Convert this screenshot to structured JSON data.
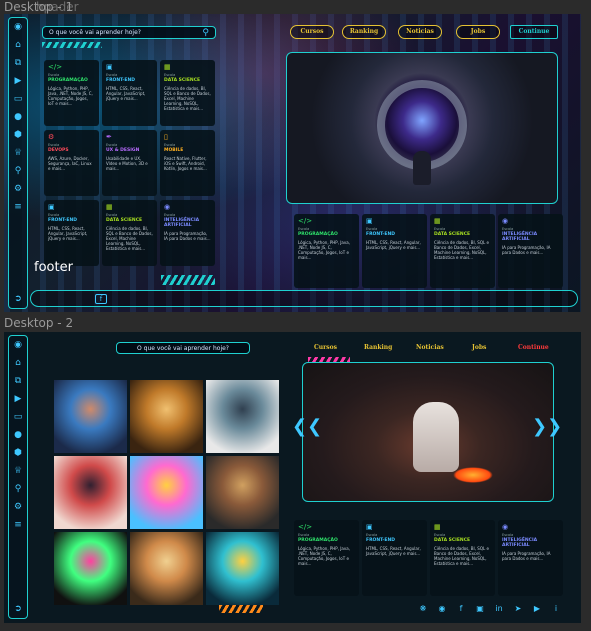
{
  "frames": {
    "desktop1_label": "Desktop - 1",
    "desktop2_label": "Desktop - 2",
    "overlap_label": "hpader"
  },
  "desktop1": {
    "search": {
      "placeholder": "O que você vai aprender hoje?"
    },
    "nav": [
      "Cursos",
      "Ranking",
      "Noticias",
      "Jobs"
    ],
    "continue_label": "Continue",
    "footer_label": "footer",
    "cards": [
      {
        "label": "Escola",
        "title": "PROGRAMAÇÃO",
        "desc": "Lógica, Python, PHP, Java, .NET, Node JS, C, Computação, Jogos, IoT e mais...",
        "color": "#2ee06a",
        "icon": "code-icon"
      },
      {
        "label": "Escola",
        "title": "FRONT-END",
        "desc": "HTML, CSS, React, Angular, JavaScript, jQuery e mais...",
        "color": "#3ec8ff",
        "icon": "window-icon"
      },
      {
        "label": "Escola",
        "title": "DATA SCIENCE",
        "desc": "Ciência de dados, BI, SQL e Banco de Dados, Excel, Machine Learning, NoSQL, Estatística e mais...",
        "color": "#a8e020",
        "icon": "grid-icon"
      },
      {
        "label": "Escola",
        "title": "DEVOPS",
        "desc": "AWS, Azure, Docker, Segurança, IaC, Linux e mais...",
        "color": "#ff4a5a",
        "icon": "gear-icon"
      },
      {
        "label": "Escola",
        "title": "UX & DESIGN",
        "desc": "Usabilidade e UX, Vídeo e Motion, 3D e mais...",
        "color": "#b86aff",
        "icon": "pen-icon"
      },
      {
        "label": "Escola",
        "title": "MOBILE",
        "desc": "React Native, Flutter, iOS e Swift, Android, Kotlin, Jogos e mais...",
        "color": "#ffb020",
        "icon": "phone-icon"
      },
      {
        "label": "Escola",
        "title": "FRONT-END",
        "desc": "HTML, CSS, React, Angular, JavaScript, jQuery e mais...",
        "color": "#3ec8ff",
        "icon": "window-icon"
      },
      {
        "label": "Escola",
        "title": "DATA SCIENCE",
        "desc": "Ciência de dados, BI, SQL e Banco de Dados, Excel, Machine Learning, NoSQL, Estatística e mais...",
        "color": "#a8e020",
        "icon": "grid-icon"
      },
      {
        "label": "Escola",
        "title": "INTELIGÊNCIA ARTIFICIAL",
        "desc": "IA para Programação, IA para Dados e mais...",
        "color": "#7a8aff",
        "icon": "robot-icon"
      }
    ],
    "bottom_cards": [
      {
        "label": "Escola",
        "title": "PROGRAMAÇÃO",
        "desc": "Lógica, Python, PHP, Java, .NET, Node JS, C, Computação, Jogos, IoT e mais...",
        "color": "#2ee06a",
        "icon": "code-icon"
      },
      {
        "label": "Escola",
        "title": "FRONT-END",
        "desc": "HTML, CSS, React, Angular, JavaScript, jQuery e mais...",
        "color": "#3ec8ff",
        "icon": "window-icon"
      },
      {
        "label": "Escola",
        "title": "DATA SCIENCE",
        "desc": "Ciência de dados, BI, SQL e Banco de Dados, Excel, Machine Learning, NoSQL, Estatística e mais...",
        "color": "#a8e020",
        "icon": "grid-icon"
      },
      {
        "label": "Escola",
        "title": "INTELIGÊNCIA ARTIFICIAL",
        "desc": "IA para Programação, IA para Dados e mais...",
        "color": "#7a8aff",
        "icon": "robot-icon"
      }
    ]
  },
  "desktop2": {
    "search": {
      "placeholder": "O que você vai aprender hoje?"
    },
    "nav": [
      "Cursos",
      "Ranking",
      "Noticias",
      "Jobs"
    ],
    "continue_label": "Continue",
    "cards": [
      {
        "label": "Escola",
        "title": "PROGRAMAÇÃO",
        "desc": "Lógica, Python, PHP, Java, .NET, Node JS, C, Computação, Jogos, IoT e mais...",
        "color": "#2ee06a",
        "icon": "code-icon"
      },
      {
        "label": "Escola",
        "title": "FRONT-END",
        "desc": "HTML, CSS, React, Angular, JavaScript, jQuery e mais...",
        "color": "#3ec8ff",
        "icon": "window-icon"
      },
      {
        "label": "Escola",
        "title": "DATA SCIENCE",
        "desc": "Ciência de dados, BI, SQL e Banco de Dados, Excel, Machine Learning, NoSQL, Estatística e mais...",
        "color": "#a8e020",
        "icon": "grid-icon"
      },
      {
        "label": "Escola",
        "title": "INTELIGÊNCIA ARTIFICIAL",
        "desc": "IA para Programação, IA para Dados e mais...",
        "color": "#7a8aff",
        "icon": "robot-icon"
      }
    ],
    "gallery": [
      {
        "name": "ai-face-blue",
        "colors": [
          "#1b2a4a",
          "#3a7ac0",
          "#d08a6a"
        ]
      },
      {
        "name": "ai-face-gold",
        "colors": [
          "#3a2410",
          "#c07a2a",
          "#f0c070"
        ]
      },
      {
        "name": "ai-face-splash",
        "colors": [
          "#e8e8e8",
          "#6a8a9a",
          "#304050"
        ]
      },
      {
        "name": "ai-face-bust",
        "colors": [
          "#f0d8d0",
          "#d04a4a",
          "#302030"
        ]
      },
      {
        "name": "ai-swirl",
        "colors": [
          "#4ac0ff",
          "#ff6ad0",
          "#ffd040"
        ]
      },
      {
        "name": "retro-tv",
        "colors": [
          "#2a2a2a",
          "#8a5a3a",
          "#d0a060"
        ]
      },
      {
        "name": "gaming-laptop",
        "colors": [
          "#101010",
          "#40ff80",
          "#ff40a0"
        ]
      },
      {
        "name": "painter-room",
        "colors": [
          "#3a2a1a",
          "#d08a4a",
          "#f0d090"
        ]
      },
      {
        "name": "vr-user",
        "colors": [
          "#0a2a3a",
          "#30c0d0",
          "#ffd040"
        ]
      }
    ],
    "social": [
      "share-icon",
      "discord-icon",
      "facebook-icon",
      "instagram-icon",
      "linkedin-icon",
      "telegram-icon",
      "youtube-icon",
      "info-icon"
    ]
  },
  "sidebar_icons": [
    "logo-avatar-icon",
    "home-icon",
    "documents-icon",
    "video-icon",
    "monitor-icon",
    "chat-icon",
    "cube-icon",
    "crown-icon",
    "search-zoom-icon",
    "settings-icon",
    "sliders-icon",
    "logout-icon"
  ],
  "accent": "#1fd0d0",
  "gold": "#e6c233"
}
